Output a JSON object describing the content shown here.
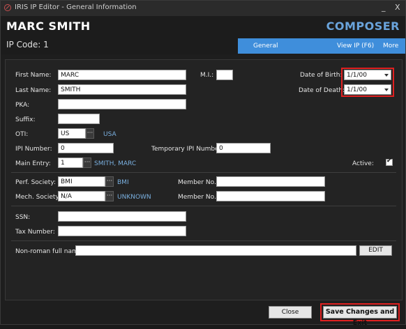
{
  "window": {
    "title": "IRIS IP Editor - General Information",
    "minimize_label": "_",
    "close_label": "X"
  },
  "header": {
    "name": "MARC SMITH",
    "role": "COMPOSER",
    "ip_code": "IP Code: 1"
  },
  "tabs": [
    {
      "label": "General",
      "active": true
    },
    {
      "label": "View IP (F6)",
      "active": false
    },
    {
      "label": "More",
      "active": false
    }
  ],
  "form": {
    "first_name": {
      "label": "First Name:",
      "value": "MARC"
    },
    "mi": {
      "label": "M.I.:",
      "value": ""
    },
    "dob": {
      "label": "Date of Birth:",
      "value": "1/1/00"
    },
    "last_name": {
      "label": "Last Name:",
      "value": "SMITH"
    },
    "dod": {
      "label": "Date of Death:",
      "value": "1/1/00"
    },
    "pka": {
      "label": "PKA:",
      "value": ""
    },
    "suffix": {
      "label": "Suffix:",
      "value": ""
    },
    "oti": {
      "label": "OTI:",
      "value": "US",
      "lookup": "···",
      "desc": "USA"
    },
    "ipi_number": {
      "label": "IPI Number:",
      "value": "0"
    },
    "temp_ipi": {
      "label": "Temporary IPI Number:",
      "value": "0"
    },
    "main_entry": {
      "label": "Main Entry:",
      "value": "1",
      "lookup": "···",
      "desc": "SMITH, MARC"
    },
    "active": {
      "label": "Active:",
      "checked": true
    },
    "perf_society": {
      "label": "Perf. Society:",
      "value": "BMI",
      "lookup": "···",
      "desc": "BMI"
    },
    "perf_member": {
      "label": "Member No.:",
      "value": ""
    },
    "mech_society": {
      "label": "Mech. Society:",
      "value": "N/A",
      "lookup": "···",
      "desc": "UNKNOWN"
    },
    "mech_member": {
      "label": "Member No.:",
      "value": ""
    },
    "ssn": {
      "label": "SSN:",
      "value": ""
    },
    "tax_number": {
      "label": "Tax Number:",
      "value": ""
    },
    "non_roman": {
      "label": "Non-roman full name:",
      "value": "",
      "edit_label": "EDIT"
    }
  },
  "footer": {
    "close_label": "Close",
    "save_label": "Save Changes and Exit"
  },
  "colors": {
    "accent": "#3f8edb",
    "role": "#6aa4dc",
    "highlight": "#e02020",
    "link": "#7ab0e0"
  }
}
